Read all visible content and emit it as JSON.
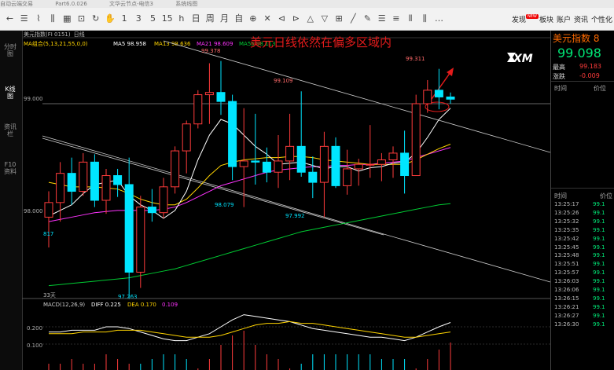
{
  "titlebar": {
    "items": [
      "自动云端交易",
      "Part6.0.026",
      "文华云节点-电信3",
      "系统线图"
    ]
  },
  "toolbar": {
    "icons": [
      "arrow-left-icon",
      "list-icon",
      "line-tool-icon",
      "candle-icon",
      "grid-icon",
      "save-icon",
      "refresh-icon",
      "hand-icon",
      "period-1-icon",
      "period-3-icon",
      "period-5-icon",
      "period-15-icon",
      "period-1h-icon",
      "period-day-icon",
      "period-week-icon",
      "period-month-icon",
      "self-icon",
      "bookmark-icon",
      "diamond-icon",
      "arrow-l-icon",
      "arrow-r-icon",
      "expand-icon",
      "collapse-icon",
      "table-icon",
      "draw-line-icon",
      "pen-icon",
      "layout1-icon",
      "layout2-icon",
      "layout3-icon",
      "layout4-icon",
      "more-icon"
    ],
    "glyphs": [
      "←",
      "☰",
      "⌇",
      "⫼",
      "▦",
      "⊡",
      "↻",
      "✋",
      "1",
      "3",
      "5",
      "15",
      "h",
      "日",
      "周",
      "月",
      "自",
      "⊕",
      "✕",
      "⊲",
      "⊳",
      "△",
      "▽",
      "⊞",
      "╱",
      "✎",
      "☰",
      "≡",
      "⫴",
      "⫼",
      "…"
    ],
    "right_items": [
      "发现",
      "板块",
      "账户",
      "资讯",
      "个性化"
    ],
    "right_badge": "NEW"
  },
  "left_tabs": [
    "分时图",
    "K线图",
    "资讯栏",
    "F10资料"
  ],
  "chart": {
    "header_symbol": "美元指数(FI 0151)",
    "header_mode": "日线",
    "ma_label": "MA组合(5,13,21,55,0,0)",
    "ma5": "MA5 98.958",
    "ma13": "MA13 98.636",
    "ma21": "MA21 98.609",
    "ma55": "MA55 98.113",
    "headline": "美元日线依然在偏多区域内",
    "logo": "XM",
    "price_labels": {
      "p99": "99.000",
      "p98": "98.000"
    },
    "annotations": {
      "h1": "99.378",
      "h2": "99.109",
      "h3": "99.311",
      "l1": "98.079",
      "l2": "97.992",
      "l3": "97.263",
      "left": "817",
      "bottom_left": "33天"
    },
    "macd_label": "MACD(12,26,9)",
    "diff": "DIFF 0.225",
    "dea": "DEA 0.170",
    "macd_val": "0.109",
    "macd_ticks": {
      "t1": "0.200",
      "t2": "0.100"
    },
    "colors": {
      "up": "#ff3b3b",
      "down": "#00e5ff",
      "ma5": "#ffffff",
      "ma13": "#ffd400",
      "ma21": "#ff33ff",
      "ma55": "#00cc33",
      "headline": "#e41b1b"
    }
  },
  "chart_data": {
    "type": "candlestick",
    "candles": [
      {
        "o": 97.99,
        "h": 98.22,
        "l": 97.72,
        "c": 98.12
      },
      {
        "o": 98.12,
        "h": 98.48,
        "l": 97.95,
        "c": 98.38
      },
      {
        "o": 98.38,
        "h": 98.52,
        "l": 98.1,
        "c": 98.22
      },
      {
        "o": 98.22,
        "h": 98.56,
        "l": 98.18,
        "c": 98.48
      },
      {
        "o": 98.48,
        "h": 98.55,
        "l": 98.08,
        "c": 98.14
      },
      {
        "o": 98.14,
        "h": 98.42,
        "l": 98.02,
        "c": 98.36
      },
      {
        "o": 98.36,
        "h": 98.42,
        "l": 98.17,
        "c": 98.28
      },
      {
        "o": 98.28,
        "h": 98.52,
        "l": 97.26,
        "c": 97.5
      },
      {
        "o": 97.5,
        "h": 98.18,
        "l": 97.36,
        "c": 98.08
      },
      {
        "o": 98.08,
        "h": 98.24,
        "l": 97.95,
        "c": 98.03
      },
      {
        "o": 98.03,
        "h": 98.34,
        "l": 97.98,
        "c": 98.26
      },
      {
        "o": 98.26,
        "h": 98.62,
        "l": 98.2,
        "c": 98.58
      },
      {
        "o": 98.58,
        "h": 98.85,
        "l": 98.38,
        "c": 98.82
      },
      {
        "o": 98.82,
        "h": 99.12,
        "l": 98.78,
        "c": 99.08
      },
      {
        "o": 99.08,
        "h": 99.36,
        "l": 98.82,
        "c": 99.1
      },
      {
        "o": 99.1,
        "h": 99.38,
        "l": 98.9,
        "c": 99.02
      },
      {
        "o": 99.02,
        "h": 99.08,
        "l": 98.32,
        "c": 98.44
      },
      {
        "o": 98.44,
        "h": 98.96,
        "l": 98.08,
        "c": 98.49
      },
      {
        "o": 98.49,
        "h": 98.91,
        "l": 98.28,
        "c": 98.48
      },
      {
        "o": 98.48,
        "h": 98.61,
        "l": 98.3,
        "c": 98.39
      },
      {
        "o": 98.39,
        "h": 98.72,
        "l": 98.25,
        "c": 98.49
      },
      {
        "o": 98.49,
        "h": 98.91,
        "l": 98.32,
        "c": 98.62
      },
      {
        "o": 98.62,
        "h": 99.11,
        "l": 98.35,
        "c": 98.39
      },
      {
        "o": 98.39,
        "h": 98.53,
        "l": 98.16,
        "c": 98.3
      },
      {
        "o": 98.3,
        "h": 98.75,
        "l": 97.99,
        "c": 98.62
      },
      {
        "o": 98.62,
        "h": 98.7,
        "l": 98.25,
        "c": 98.27
      },
      {
        "o": 98.27,
        "h": 98.59,
        "l": 98.19,
        "c": 98.42
      },
      {
        "o": 98.42,
        "h": 98.51,
        "l": 98.27,
        "c": 98.46
      },
      {
        "o": 98.46,
        "h": 98.81,
        "l": 98.34,
        "c": 98.46
      },
      {
        "o": 98.46,
        "h": 98.56,
        "l": 98.31,
        "c": 98.5
      },
      {
        "o": 98.5,
        "h": 98.62,
        "l": 98.34,
        "c": 98.56
      },
      {
        "o": 98.56,
        "h": 98.76,
        "l": 98.2,
        "c": 98.36
      },
      {
        "o": 98.36,
        "h": 99.08,
        "l": 98.36,
        "c": 99.0
      },
      {
        "o": 99.0,
        "h": 99.21,
        "l": 98.92,
        "c": 99.12
      },
      {
        "o": 99.12,
        "h": 99.31,
        "l": 98.95,
        "c": 99.06
      },
      {
        "o": 99.06,
        "h": 99.1,
        "l": 99.0,
        "c": 99.04
      }
    ],
    "ma5": [
      98.0,
      98.05,
      98.1,
      98.2,
      98.28,
      98.3,
      98.32,
      98.18,
      98.1,
      98.05,
      97.98,
      98.05,
      98.22,
      98.5,
      98.72,
      98.86,
      98.82,
      98.72,
      98.62,
      98.55,
      98.46,
      98.47,
      98.48,
      98.45,
      98.42,
      98.44,
      98.44,
      98.4,
      98.43,
      98.44,
      98.47,
      98.48,
      98.56,
      98.7,
      98.86,
      98.96
    ],
    "ma13": [
      98.3,
      98.28,
      98.26,
      98.26,
      98.26,
      98.25,
      98.24,
      98.2,
      98.15,
      98.12,
      98.1,
      98.1,
      98.15,
      98.25,
      98.36,
      98.45,
      98.48,
      98.5,
      98.51,
      98.52,
      98.52,
      98.53,
      98.53,
      98.52,
      98.5,
      98.49,
      98.48,
      98.47,
      98.46,
      98.46,
      98.46,
      98.46,
      98.5,
      98.55,
      98.6,
      98.64
    ],
    "ma21": [
      97.95,
      97.97,
      97.99,
      98.01,
      98.03,
      98.04,
      98.05,
      98.05,
      98.05,
      98.05,
      98.06,
      98.08,
      98.12,
      98.17,
      98.22,
      98.27,
      98.3,
      98.33,
      98.36,
      98.39,
      98.41,
      98.42,
      98.43,
      98.44,
      98.44,
      98.45,
      98.45,
      98.46,
      98.46,
      98.47,
      98.48,
      98.49,
      98.52,
      98.55,
      98.58,
      98.61
    ],
    "ma55": [
      97.38,
      97.39,
      97.4,
      97.41,
      97.42,
      97.43,
      97.44,
      97.45,
      97.47,
      97.49,
      97.51,
      97.53,
      97.56,
      97.59,
      97.62,
      97.65,
      97.68,
      97.71,
      97.74,
      97.77,
      97.8,
      97.83,
      97.86,
      97.88,
      97.9,
      97.92,
      97.94,
      97.96,
      97.98,
      98.0,
      98.02,
      98.04,
      98.06,
      98.08,
      98.1,
      98.11
    ],
    "diff": [
      0.17,
      0.17,
      0.18,
      0.18,
      0.18,
      0.2,
      0.2,
      0.19,
      0.17,
      0.15,
      0.13,
      0.12,
      0.12,
      0.14,
      0.16,
      0.2,
      0.24,
      0.27,
      0.26,
      0.25,
      0.24,
      0.23,
      0.21,
      0.19,
      0.18,
      0.17,
      0.16,
      0.15,
      0.14,
      0.14,
      0.13,
      0.12,
      0.14,
      0.17,
      0.2,
      0.225
    ],
    "dea": [
      0.16,
      0.16,
      0.16,
      0.17,
      0.17,
      0.17,
      0.18,
      0.18,
      0.18,
      0.17,
      0.16,
      0.15,
      0.14,
      0.14,
      0.14,
      0.15,
      0.17,
      0.19,
      0.21,
      0.22,
      0.22,
      0.23,
      0.22,
      0.22,
      0.21,
      0.2,
      0.19,
      0.18,
      0.17,
      0.16,
      0.15,
      0.14,
      0.14,
      0.15,
      0.16,
      0.17
    ],
    "y_axis_price_labels": [
      "99.000",
      "98.000"
    ],
    "macd_axis_labels": [
      "0.200",
      "0.100"
    ]
  },
  "right_panel": {
    "title": "美元指数",
    "title_suffix": "8",
    "price": "99.098",
    "high_label": "最高",
    "high": "99.183",
    "change_label": "涨跌",
    "change": "-0.009",
    "col_time": "时间",
    "col_price": "价位",
    "ticks": [
      {
        "time": "13:25:17",
        "price": "99.1"
      },
      {
        "time": "13:25:26",
        "price": "99.1"
      },
      {
        "time": "13:25:32",
        "price": "99.1"
      },
      {
        "time": "13:25:35",
        "price": "99.1"
      },
      {
        "time": "13:25:42",
        "price": "99.1"
      },
      {
        "time": "13:25:45",
        "price": "99.1"
      },
      {
        "time": "13:25:48",
        "price": "99.1"
      },
      {
        "time": "13:25:51",
        "price": "99.1"
      },
      {
        "time": "13:25:57",
        "price": "99.1"
      },
      {
        "time": "13:26:03",
        "price": "99.1"
      },
      {
        "time": "13:26:06",
        "price": "99.1"
      },
      {
        "time": "13:26:15",
        "price": "99.1"
      },
      {
        "time": "13:26:21",
        "price": "99.1"
      },
      {
        "time": "13:26:27",
        "price": "99.1"
      },
      {
        "time": "13:26:30",
        "price": "99.1"
      }
    ]
  }
}
